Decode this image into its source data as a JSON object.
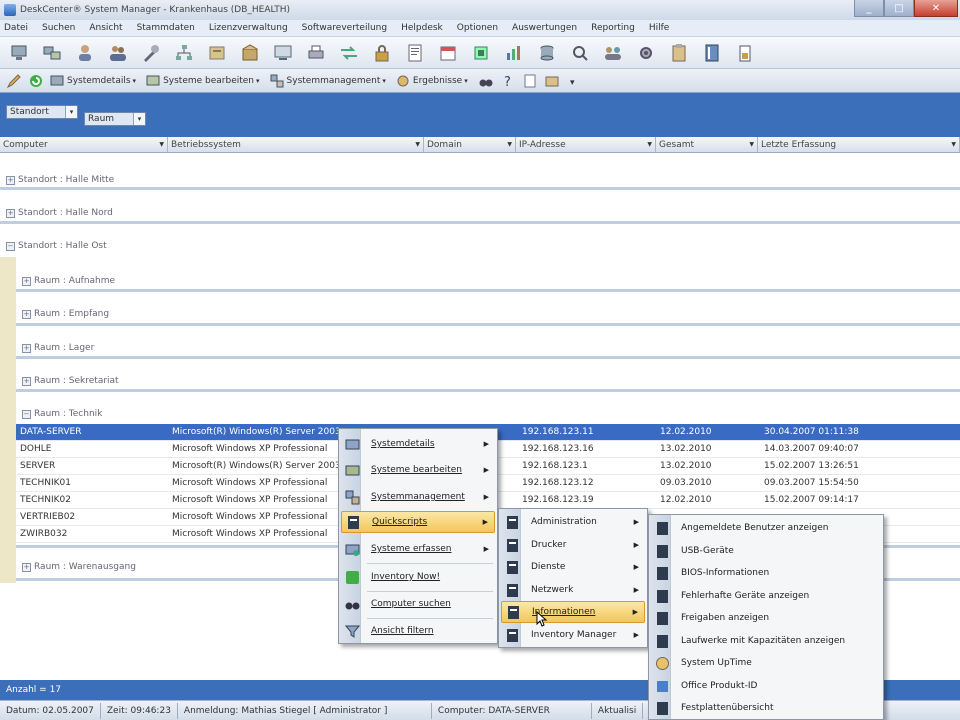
{
  "window": {
    "title": "DeskCenter® System Manager - Krankenhaus (DB_HEALTH)",
    "controls": [
      "_",
      "□",
      "✕"
    ]
  },
  "menubar": [
    "Datei",
    "Suchen",
    "Ansicht",
    "Stammdaten",
    "Lizenzverwaltung",
    "Softwareverteilung",
    "Helpdesk",
    "Optionen",
    "Auswertungen",
    "Reporting",
    "Hilfe"
  ],
  "toolbar2": {
    "buttons": [
      "Systemdetails",
      "Systeme bearbeiten",
      "Systemmanagement",
      "Ergebnisse"
    ]
  },
  "groupbar": {
    "chips": [
      "Standort",
      "Raum"
    ]
  },
  "columns": [
    "Computer",
    "Betriebssystem",
    "Domain",
    "IP-Adresse",
    "Gesamt",
    "Letzte Erfassung"
  ],
  "groups": {
    "standorte": [
      "Standort : Halle Mitte",
      "Standort : Halle Nord",
      "Standort : Halle Ost"
    ],
    "raeume": [
      "Raum : Aufnahme",
      "Raum : Empfang",
      "Raum : Lager",
      "Raum : Sekretariat",
      "Raum : Technik"
    ],
    "raum_last": "Raum : Warenausgang"
  },
  "rows": [
    {
      "computer": "DATA-SERVER",
      "os": "Microsoft(R) Windows(R) Server 2003",
      "ip": "192.168.123.11",
      "gesamt": "12.02.2010",
      "erfassung": "30.04.2007 01:11:38",
      "selected": true
    },
    {
      "computer": "DOHLE",
      "os": "Microsoft Windows XP Professional",
      "ip": "192.168.123.16",
      "gesamt": "13.02.2010",
      "erfassung": "14.03.2007 09:40:07"
    },
    {
      "computer": "SERVER",
      "os": "Microsoft(R) Windows(R) Server 2003",
      "ip": "192.168.123.1",
      "gesamt": "13.02.2010",
      "erfassung": "15.02.2007 13:26:51"
    },
    {
      "computer": "TECHNIK01",
      "os": "Microsoft Windows XP Professional",
      "ip": "192.168.123.12",
      "gesamt": "09.03.2010",
      "erfassung": "09.03.2007 15:54:50"
    },
    {
      "computer": "TECHNIK02",
      "os": "Microsoft Windows XP Professional",
      "ip": "192.168.123.19",
      "gesamt": "12.02.2010",
      "erfassung": "15.02.2007 09:14:17"
    },
    {
      "computer": "VERTRIEB02",
      "os": "Microsoft Windows XP Professional",
      "ip": "",
      "gesamt": "",
      "erfassung": ""
    },
    {
      "computer": "ZWIRB032",
      "os": "Microsoft Windows XP Professional",
      "ip": "",
      "gesamt": "",
      "erfassung": ""
    }
  ],
  "context_menu": {
    "items": [
      "Systemdetails",
      "Systeme bearbeiten",
      "Systemmanagement",
      "Quickscripts",
      "Systeme erfassen",
      "Inventory Now!",
      "Computer suchen",
      "Ansicht filtern"
    ]
  },
  "submenu_quickscripts": {
    "items": [
      "Administration",
      "Drucker",
      "Dienste",
      "Netzwerk",
      "Informationen",
      "Inventory Manager"
    ]
  },
  "submenu_informationen": {
    "items": [
      "Angemeldete Benutzer anzeigen",
      "USB-Geräte",
      "BIOS-Informationen",
      "Fehlerhafte Geräte anzeigen",
      "Freigaben anzeigen",
      "Laufwerke mit Kapazitäten anzeigen",
      "System UpTime",
      "Office Produkt-ID",
      "Festplattenübersicht"
    ]
  },
  "statusbar": {
    "count": "Anzahl = 17",
    "datum": "Datum: 02.05.2007",
    "zeit": "Zeit: 09:46:23",
    "anmeldung": "Anmeldung: Mathias Stiegel [ Administrator ]",
    "computer": "Computer: DATA-SERVER",
    "aktual": "Aktualisi"
  },
  "colors": {
    "accent": "#3c6fba",
    "selection": "#3a6bc4",
    "highlight": "#f4c65a"
  }
}
